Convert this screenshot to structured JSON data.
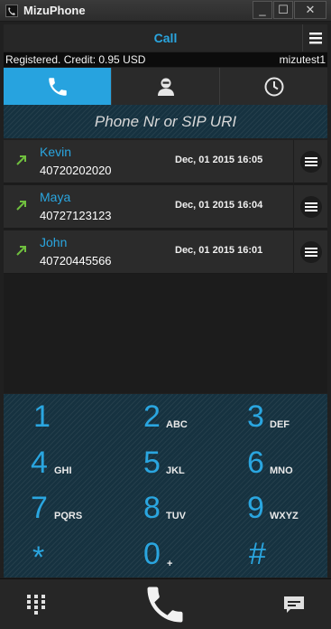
{
  "window": {
    "title": "MizuPhone",
    "min_glyph": "_",
    "max_glyph": "☐",
    "close_glyph": "✕"
  },
  "header": {
    "title": "Call"
  },
  "status": {
    "left": "Registered. Credit: 0.95 USD",
    "right": "mizutest1"
  },
  "tabs": [
    {
      "icon": "phone-icon",
      "active": true
    },
    {
      "icon": "contact-icon",
      "active": false
    },
    {
      "icon": "clock-icon",
      "active": false
    }
  ],
  "search": {
    "placeholder": "Phone Nr or SIP URI",
    "value": ""
  },
  "calls": [
    {
      "name": "Kevin",
      "number": "40720202020",
      "time": "Dec, 01  2015  16:05",
      "icon": "outgoing-call-icon"
    },
    {
      "name": "Maya",
      "number": "40727123123",
      "time": "Dec, 01  2015  16:04",
      "icon": "outgoing-call-icon"
    },
    {
      "name": "John",
      "number": "40720445566",
      "time": "Dec, 01  2015  16:01",
      "icon": "outgoing-call-icon"
    }
  ],
  "keypad": [
    {
      "digit": "1",
      "letters": ""
    },
    {
      "digit": "2",
      "letters": "ABC"
    },
    {
      "digit": "3",
      "letters": "DEF"
    },
    {
      "digit": "4",
      "letters": "GHI"
    },
    {
      "digit": "5",
      "letters": "JKL"
    },
    {
      "digit": "6",
      "letters": "MNO"
    },
    {
      "digit": "7",
      "letters": "PQRS"
    },
    {
      "digit": "8",
      "letters": "TUV"
    },
    {
      "digit": "9",
      "letters": "WXYZ"
    },
    {
      "digit": "*",
      "letters": ""
    },
    {
      "digit": "0",
      "letters": "+"
    },
    {
      "digit": "#",
      "letters": ""
    }
  ],
  "colors": {
    "accent": "#27a3df",
    "green": "#6fbf3e",
    "background": "#202020"
  }
}
